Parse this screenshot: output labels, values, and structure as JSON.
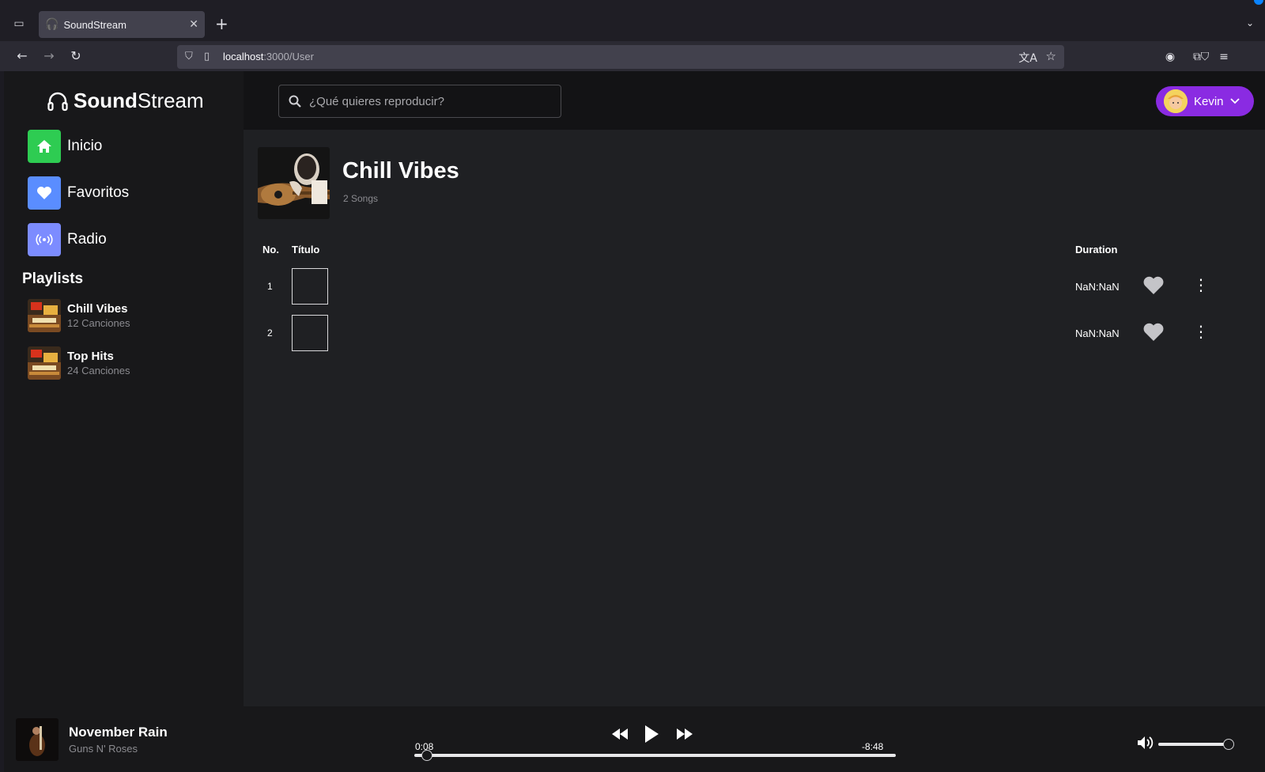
{
  "browser": {
    "tab_title": "SoundStream",
    "url_host": "localhost",
    "url_rest": ":3000/User"
  },
  "brand": {
    "bold": "Sound",
    "light": "Stream"
  },
  "nav": {
    "items": [
      {
        "label": "Inicio",
        "icon": "home-icon",
        "color": "#2ecc52"
      },
      {
        "label": "Favoritos",
        "icon": "heart-icon",
        "color": "#5a8dff"
      },
      {
        "label": "Radio",
        "icon": "radio-icon",
        "color": "#7c8cff"
      }
    ]
  },
  "playlists": {
    "heading": "Playlists",
    "items": [
      {
        "name": "Chill Vibes",
        "count": "12 Canciones"
      },
      {
        "name": "Top Hits",
        "count": "24 Canciones"
      }
    ]
  },
  "search": {
    "placeholder": "¿Qué quieres reproducir?"
  },
  "user": {
    "name": "Kevin",
    "accent": "#8a2be2"
  },
  "playlist_view": {
    "title": "Chill Vibes",
    "count": "2 Songs",
    "columns": {
      "no": "No.",
      "title": "Título",
      "duration": "Duration"
    },
    "rows": [
      {
        "no": "1",
        "duration": "NaN:NaN"
      },
      {
        "no": "2",
        "duration": "NaN:NaN"
      }
    ]
  },
  "player": {
    "title": "November Rain",
    "artist": "Guns N' Roses",
    "elapsed": "0:08",
    "remaining": "-8:48",
    "progress_fraction": 0.015,
    "volume_fraction": 1.0
  }
}
